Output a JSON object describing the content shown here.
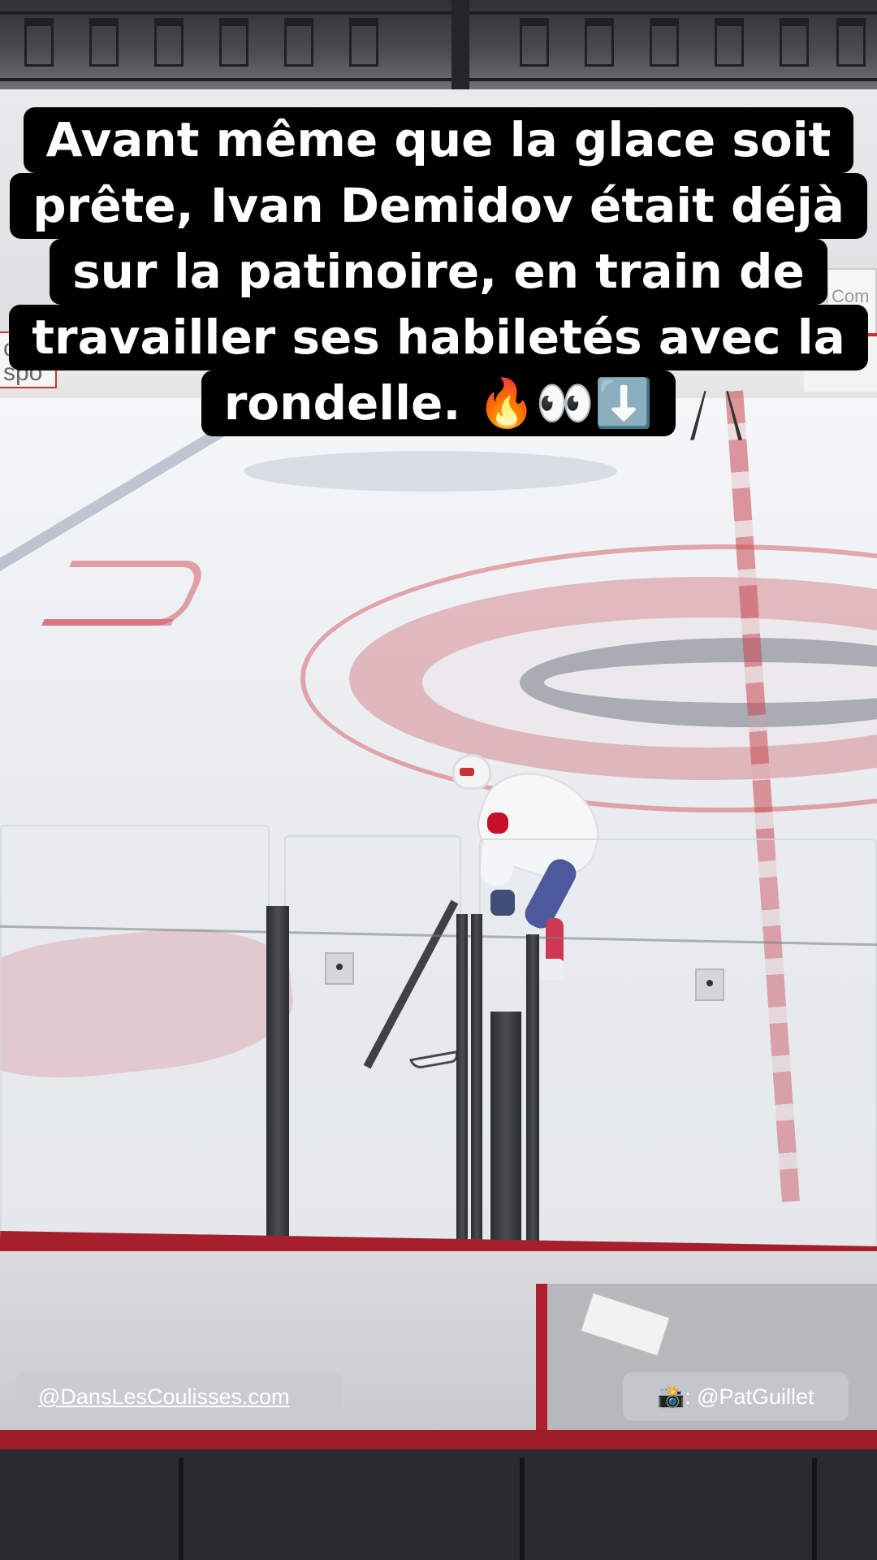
{
  "caption": {
    "lines": [
      "Avant même que la glace soit",
      "prête, Ivan Demidov était déjà",
      "sur la patinoire, en train de",
      "travailler ses habiletés avec la",
      "rondelle. 🔥👀⬇️"
    ]
  },
  "tags": {
    "source": "@DansLesCoulisses.com",
    "photo_icon": "📸",
    "photo_credit": ": @PatGuillet"
  },
  "background_signage": {
    "left": "omple spo",
    "right": "Com sp"
  },
  "colors": {
    "caption_bg": "#000000",
    "caption_text": "#ffffff",
    "tag_bg": "#c8cbd0",
    "team_red": "#c8102e",
    "team_blue": "#2a3a8a"
  }
}
